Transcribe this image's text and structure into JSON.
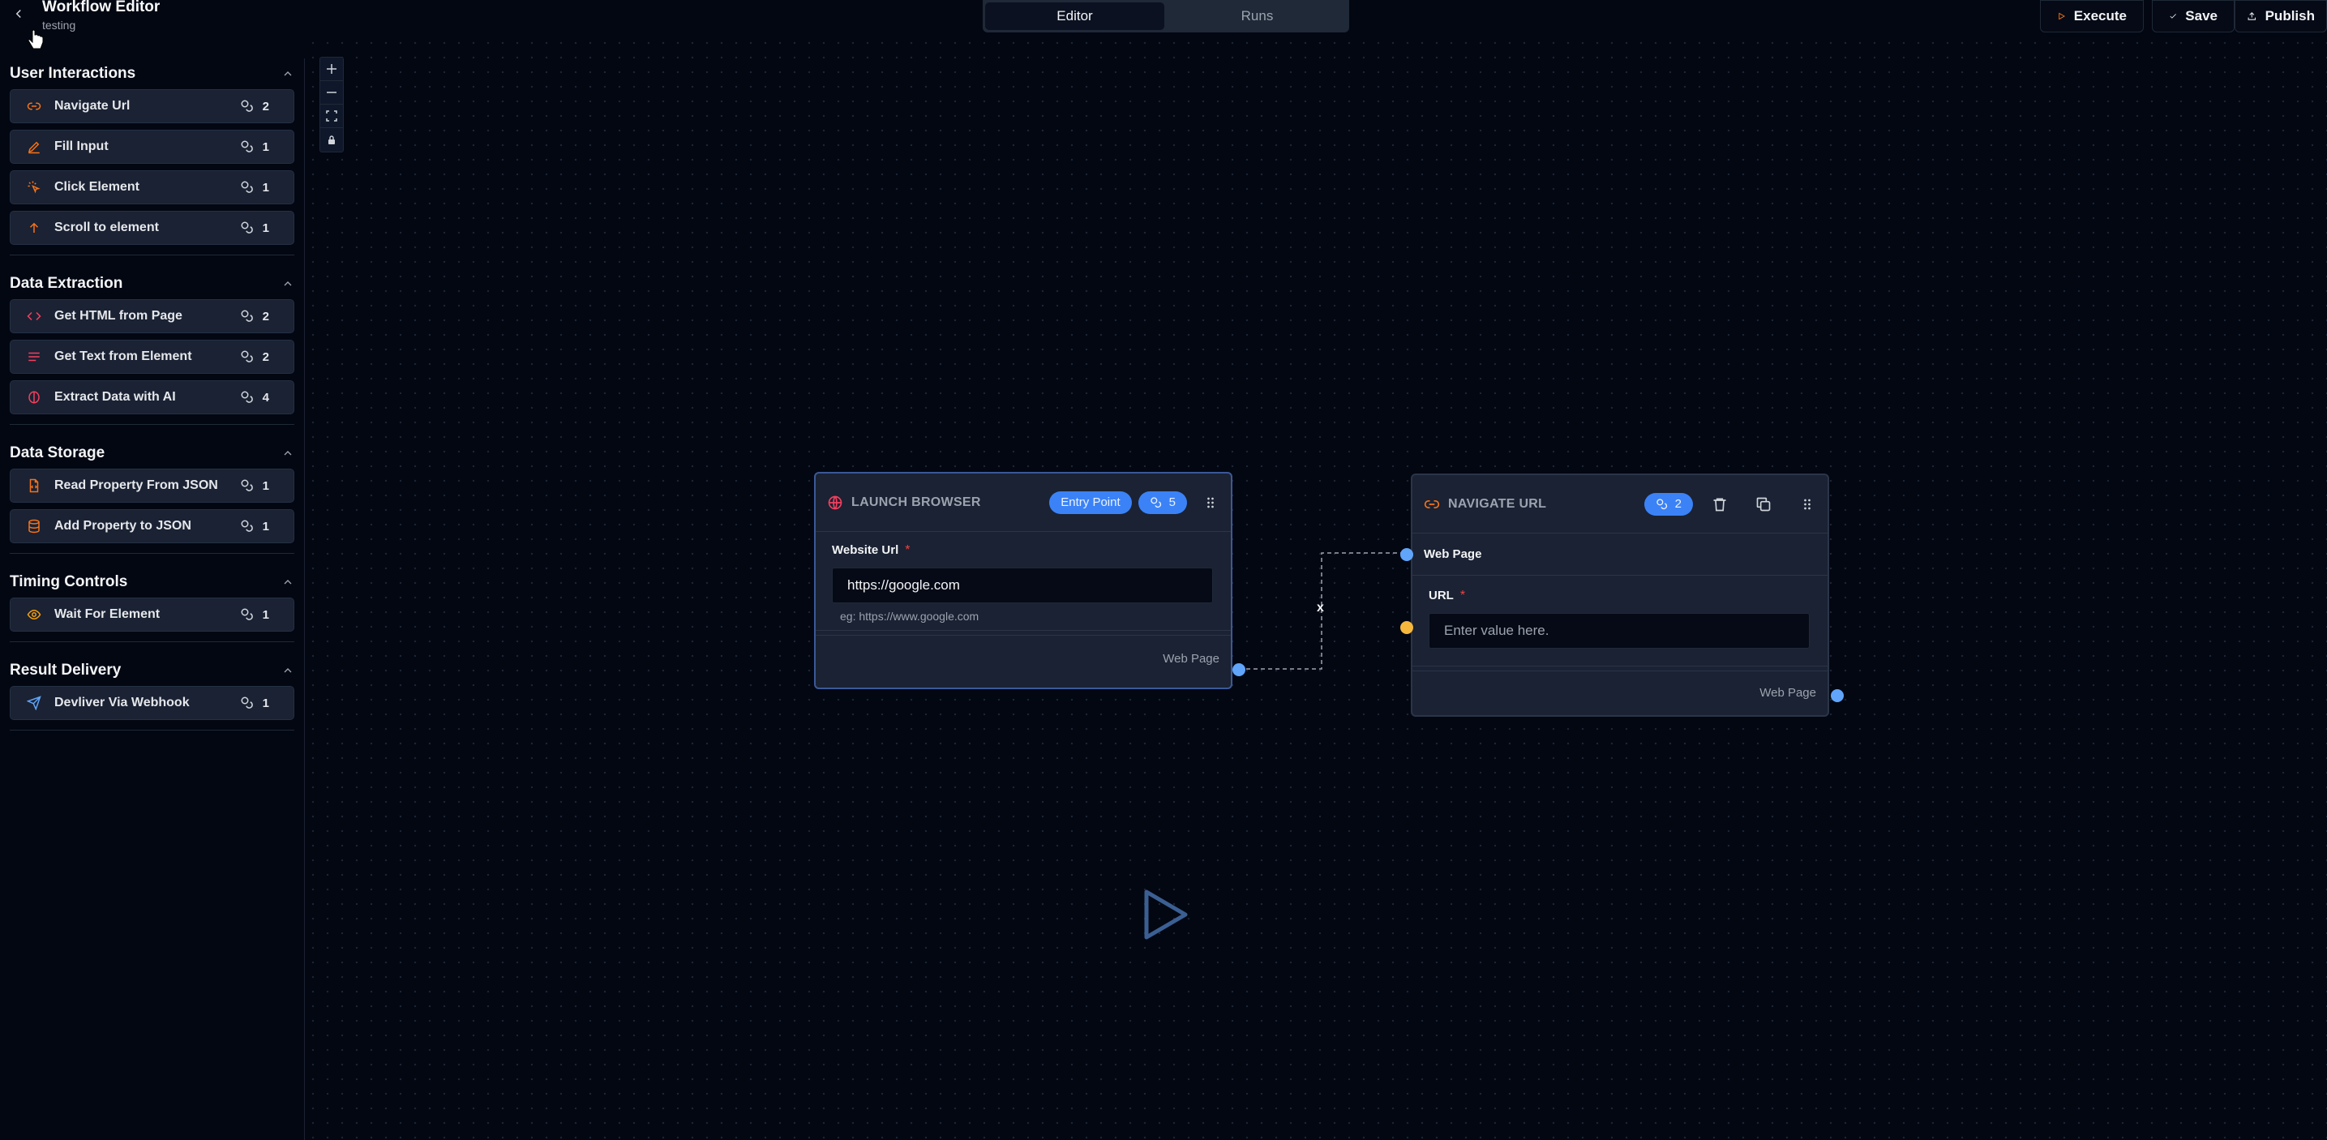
{
  "header": {
    "title": "Workflow Editor",
    "subtitle": "testing",
    "tabs": [
      {
        "label": "Editor",
        "active": true
      },
      {
        "label": "Runs",
        "active": false
      }
    ],
    "actions": {
      "execute": "Execute",
      "save": "Save",
      "publish": "Publish"
    }
  },
  "sidebar": {
    "sections": [
      {
        "title": "User Interactions",
        "items": [
          {
            "label": "Navigate Url",
            "count": "2",
            "icon": "link-icon"
          },
          {
            "label": "Fill Input",
            "count": "1",
            "icon": "pencil-icon"
          },
          {
            "label": "Click Element",
            "count": "1",
            "icon": "pointer-click-icon"
          },
          {
            "label": "Scroll to element",
            "count": "1",
            "icon": "arrow-up-icon"
          }
        ]
      },
      {
        "title": "Data Extraction",
        "items": [
          {
            "label": "Get HTML from Page",
            "count": "2",
            "icon": "code-icon"
          },
          {
            "label": "Get Text from Element",
            "count": "2",
            "icon": "text-lines-icon"
          },
          {
            "label": "Extract Data with AI",
            "count": "4",
            "icon": "brain-icon"
          }
        ]
      },
      {
        "title": "Data Storage",
        "items": [
          {
            "label": "Read Property From JSON",
            "count": "1",
            "icon": "file-json-icon"
          },
          {
            "label": "Add Property to JSON",
            "count": "1",
            "icon": "database-icon"
          }
        ]
      },
      {
        "title": "Timing Controls",
        "items": [
          {
            "label": "Wait For Element",
            "count": "1",
            "icon": "eye-icon"
          }
        ]
      },
      {
        "title": "Result Delivery",
        "items": [
          {
            "label": "Devliver Via Webhook",
            "count": "1",
            "icon": "send-icon"
          }
        ]
      }
    ]
  },
  "nodes": {
    "launch": {
      "title": "LAUNCH BROWSER",
      "entry_badge": "Entry Point",
      "credits": "5",
      "field_label": "Website Url",
      "field_value": "https://google.com",
      "hint": "eg: https://www.google.com",
      "output_label": "Web Page"
    },
    "navigate": {
      "title": "NAVIGATE URL",
      "credits": "2",
      "input_label": "Web Page",
      "field_label": "URL",
      "field_placeholder": "Enter value here.",
      "output_label": "Web Page"
    }
  },
  "edge": {
    "delete_label": "x"
  },
  "colors": {
    "accent": "#3b82f6",
    "handle_blue": "#60a5fa",
    "handle_yellow": "#f5b83d",
    "required": "#ef4444",
    "icon_orange": "#f97316",
    "icon_pink": "#f43f5e"
  }
}
